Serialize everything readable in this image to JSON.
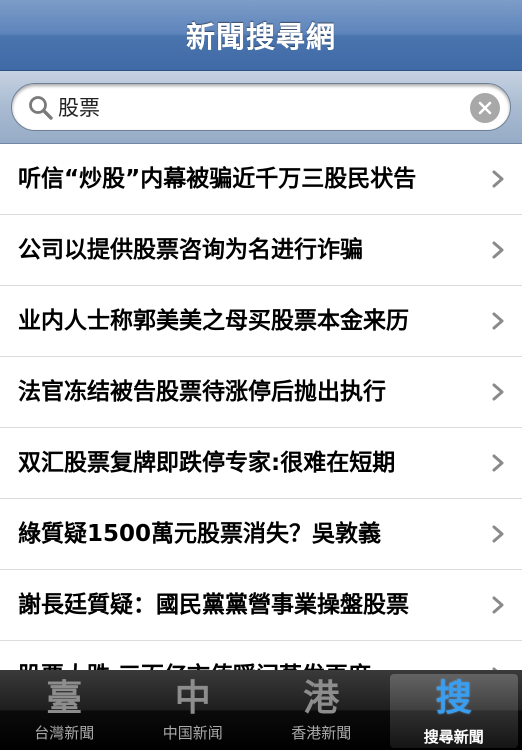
{
  "navbar": {
    "title": "新聞搜尋網"
  },
  "search": {
    "value": "股票"
  },
  "results": [
    "听信“炒股”内幕被骗近千万三股民状告",
    "公司以提供股票咨询为名进行诈骗",
    "业内人士称郭美美之母买股票本金来历",
    "法官冻结被告股票待涨停后抛出执行",
    "双汇股票复牌即跌停专家:很难在短期",
    "綠質疑1500萬元股票消失？吳敦義",
    "謝長廷質疑：國民黨黨營事業操盤股票",
    "股票大跌 三百亿市值瞬间蒸发再度"
  ],
  "tabs": [
    {
      "icon": "臺",
      "label": "台灣新聞",
      "icon_name": "taiwan-news-icon"
    },
    {
      "icon": "中",
      "label": "中国新闻",
      "icon_name": "china-news-icon"
    },
    {
      "icon": "港",
      "label": "香港新聞",
      "icon_name": "hongkong-news-icon"
    },
    {
      "icon": "搜",
      "label": "搜尋新聞",
      "icon_name": "search-news-icon",
      "active": true
    }
  ],
  "colors": {
    "navbar": "#5d84bb",
    "active_tab_icon": "#3a9ef0",
    "tabbar": "#000000"
  }
}
